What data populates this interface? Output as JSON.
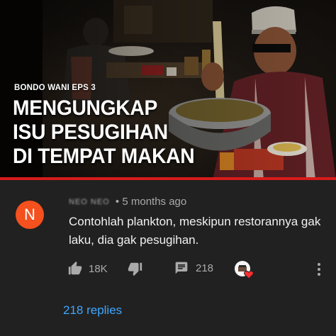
{
  "thumbnail": {
    "episode_label": "BONDO WANI EPS 3",
    "headline_lines": [
      "MENGUNGKAP",
      "ISU PESUGIHAN",
      "DI TEMPAT MAKAN"
    ]
  },
  "comment": {
    "avatar_letter": "N",
    "author": "NEO NEO",
    "separator": "•",
    "time": "5 months ago",
    "text": "Contohlah plankton, meskipun restorannya gak laku, dia gak pesugihan.",
    "likes": "18K",
    "replies_count": "218",
    "view_replies": "218 replies"
  },
  "colors": {
    "background": "#212121",
    "avatar": "#f4511e",
    "link": "#3ea6ff",
    "accent_red": "#d81b1b"
  },
  "icons": [
    "thumbs-up-icon",
    "thumbs-down-icon",
    "comment-icon",
    "creator-heart-icon"
  ]
}
